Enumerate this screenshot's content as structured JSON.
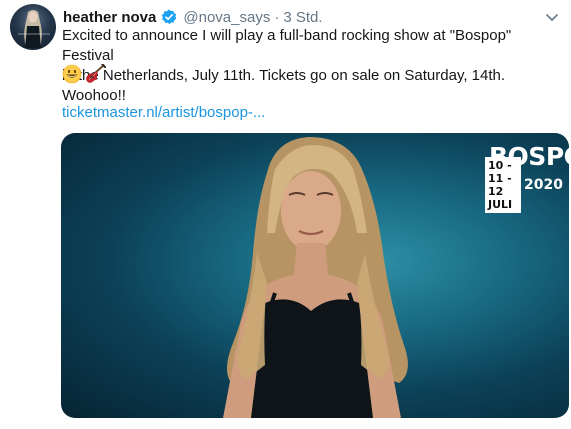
{
  "tweet": {
    "author_name": "heather nova",
    "handle": "@nova_says",
    "separator": "·",
    "time": "3 Std.",
    "text": "Excited to announce I will play a full-band rocking show at \"Bospop\" Festival\nin the Netherlands, July 11th. Tickets go on sale on Saturday, 14th. Woohoo!!",
    "emojis": [
      "grinning-face-icon",
      "guitar-icon"
    ],
    "link": "ticketmaster.nl/artist/bospop-...",
    "media": {
      "festival_logo": "BOSPOP",
      "festival_dates": "10 - 11 - 12 JULI",
      "festival_year": "2020"
    }
  },
  "colors": {
    "link": "#1b95e0",
    "secondary_text": "#657786",
    "verified": "#1da1f2",
    "media_bg": "#186a83"
  }
}
